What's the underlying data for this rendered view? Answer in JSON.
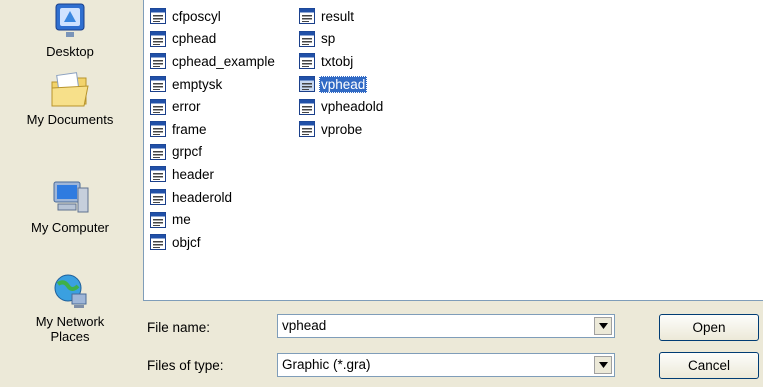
{
  "places": [
    {
      "label": "Desktop",
      "icon": "desktop-icon"
    },
    {
      "label": "My Documents",
      "icon": "my-documents-icon"
    },
    {
      "label": "My Computer",
      "icon": "my-computer-icon"
    },
    {
      "label": "My Network\nPlaces",
      "icon": "my-network-places-icon"
    }
  ],
  "files": {
    "column1": [
      "cfposcyl",
      "cphead",
      "cphead_example",
      "emptysk",
      "error",
      "frame",
      "grpcf",
      "header",
      "headerold",
      "me",
      "objcf"
    ],
    "column2": [
      "result",
      "sp",
      "txtobj",
      "vphead",
      "vpheadold",
      "vprobe"
    ],
    "selected": "vphead"
  },
  "form": {
    "file_name_label": "File name:",
    "file_name_value": "vphead",
    "file_type_label": "Files of type:",
    "file_type_value": "Graphic (*.gra)",
    "open_label": "Open",
    "cancel_label": "Cancel"
  },
  "colors": {
    "selection": "#316ac5",
    "dialog_bg": "#ece9d8",
    "border": "#7f9db9"
  }
}
